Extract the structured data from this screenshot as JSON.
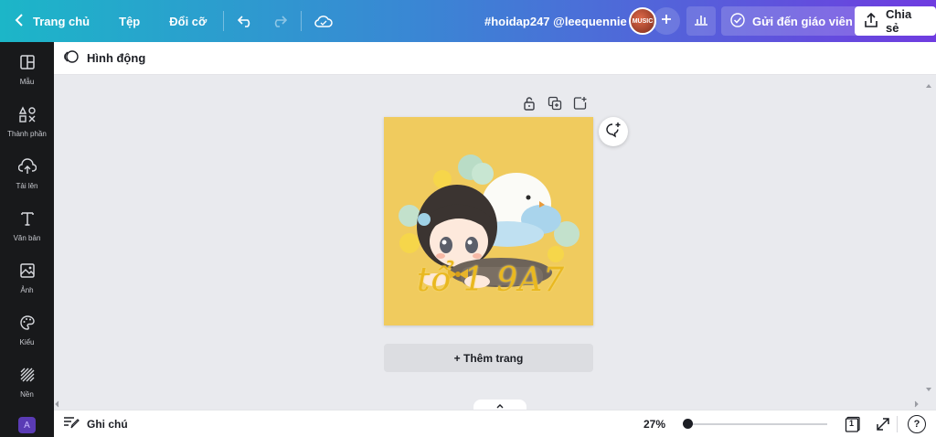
{
  "topbar": {
    "home_label": "Trang chủ",
    "file_label": "Tệp",
    "resize_label": "Đổi cỡ",
    "doc_title": "#hoidap247 @leequennie",
    "avatar_text": "MUSIC",
    "send_label": "Gửi đến giáo viên",
    "share_label": "Chia sẻ",
    "gradient_start": "#1cb6c8",
    "gradient_end": "#6f3ce0"
  },
  "sidebar": {
    "items": [
      {
        "label": "Mẫu",
        "icon": "template-icon"
      },
      {
        "label": "Thành phần",
        "icon": "elements-icon"
      },
      {
        "label": "Tải lên",
        "icon": "upload-icon"
      },
      {
        "label": "Văn bản",
        "icon": "text-icon"
      },
      {
        "label": "Ảnh",
        "icon": "photo-icon"
      },
      {
        "label": "Kiểu",
        "icon": "palette-icon"
      },
      {
        "label": "Nền",
        "icon": "background-icon"
      }
    ],
    "apps_glyph": "A"
  },
  "subbar": {
    "animate_label": "Hình động"
  },
  "canvas": {
    "artwork_text": "tổ 1 9A7",
    "background_color": "#f0cb5e",
    "add_page_label": "+ Thêm trang"
  },
  "bottombar": {
    "notes_label": "Ghi chú",
    "zoom_label": "27%",
    "page_count": "1",
    "help_glyph": "?"
  }
}
